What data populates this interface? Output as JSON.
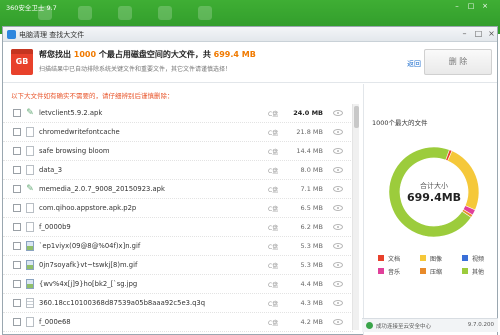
{
  "app": {
    "title": "360安全卫士 9.7"
  },
  "window": {
    "title": "电脑清理 查找大文件"
  },
  "header": {
    "main_prefix": "帮您找出 ",
    "count": "1000",
    "main_middle": " 个最占用磁盘空间的大文件，共 ",
    "total": "699.4 MB",
    "sub": "扫描结果中已自动排除系统关键文件和重要文件，其它文件请谨慎选择！",
    "back_label": "返回",
    "delete_label": "删 除"
  },
  "notice": "以下大文件如有确实不需要的，请仔细辨别后谨慎删除：",
  "files": [
    {
      "name": "letvclient5.9.2.apk",
      "disk": "C盘",
      "size": "24.0 MB",
      "icon": "apk"
    },
    {
      "name": "chromedwritefontcache",
      "disk": "C盘",
      "size": "21.8 MB",
      "icon": "doc"
    },
    {
      "name": "safe browsing bloom",
      "disk": "C盘",
      "size": "14.4 MB",
      "icon": "doc"
    },
    {
      "name": "data_3",
      "disk": "C盘",
      "size": "8.0 MB",
      "icon": "doc"
    },
    {
      "name": "memedia_2.0.7_9008_20150923.apk",
      "disk": "C盘",
      "size": "7.1 MB",
      "icon": "apk"
    },
    {
      "name": "com.qihoo.appstore.apk.p2p",
      "disk": "C盘",
      "size": "6.5 MB",
      "icon": "doc"
    },
    {
      "name": "f_0000b9",
      "disk": "C盘",
      "size": "6.2 MB",
      "icon": "doc"
    },
    {
      "name": "`ep1viyx(09@8@%04f)x]n.gif",
      "disk": "C盘",
      "size": "5.3 MB",
      "icon": "img"
    },
    {
      "name": "0jn7soyafk}vt~tswkj[8)m.gif",
      "disk": "C盘",
      "size": "5.3 MB",
      "icon": "img"
    },
    {
      "name": "{wv%4x[j]9}ho[bk2_[`sg.jpg",
      "disk": "C盘",
      "size": "4.4 MB",
      "icon": "img"
    },
    {
      "name": "360.18cc10100368d87539a05b8aaa92c5e3.q3q",
      "disk": "C盘",
      "size": "4.3 MB",
      "icon": "txt"
    },
    {
      "name": "f_000e68",
      "disk": "C盘",
      "size": "4.2 MB",
      "icon": "doc"
    }
  ],
  "right_panel": {
    "title": "1000个最大的文件",
    "center_label": "合计大小",
    "center_value": "699.4MB",
    "legend": [
      {
        "label": "文档",
        "color": "#e8412b"
      },
      {
        "label": "图像",
        "color": "#f5c83a"
      },
      {
        "label": "视频",
        "color": "#3a6fd8"
      },
      {
        "label": "音乐",
        "color": "#e0409a"
      },
      {
        "label": "压缩",
        "color": "#e88a2a"
      },
      {
        "label": "其他",
        "color": "#9ccc3c"
      }
    ]
  },
  "chart_data": {
    "type": "pie",
    "title": "1000个最大的文件",
    "categories": [
      "文档",
      "图像",
      "视频",
      "音乐",
      "压缩",
      "其他"
    ],
    "values": [
      1,
      25,
      0,
      2,
      1,
      71
    ],
    "colors": [
      "#e8412b",
      "#f5c83a",
      "#3a6fd8",
      "#e0409a",
      "#e88a2a",
      "#9ccc3c"
    ]
  },
  "status": {
    "text": "成功连接至云安全中心",
    "version": "9.7.0.200"
  }
}
